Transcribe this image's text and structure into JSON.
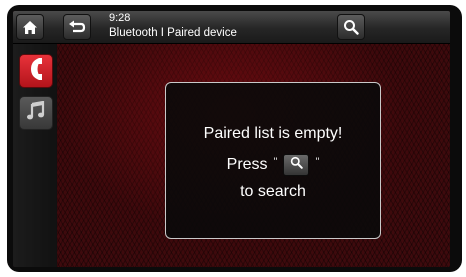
{
  "header": {
    "home_icon": "home-icon",
    "back_icon": "back-arrow-icon",
    "time": "9:28",
    "breadcrumb": "Bluetooth I Paired device",
    "search_icon": "search-icon"
  },
  "sidebar": {
    "items": [
      {
        "name": "phone",
        "icon": "phone-icon",
        "active": true
      },
      {
        "name": "music",
        "icon": "music-note-icon",
        "active": false
      }
    ]
  },
  "dialog": {
    "line1": "Paired list is empty!",
    "press": "Press",
    "quote_open": "\"",
    "quote_close": "\"",
    "line3": "to search"
  },
  "colors": {
    "accent": "#d8262e",
    "background": "#3e0a0d",
    "dialog_border": "#c9c9c9"
  }
}
